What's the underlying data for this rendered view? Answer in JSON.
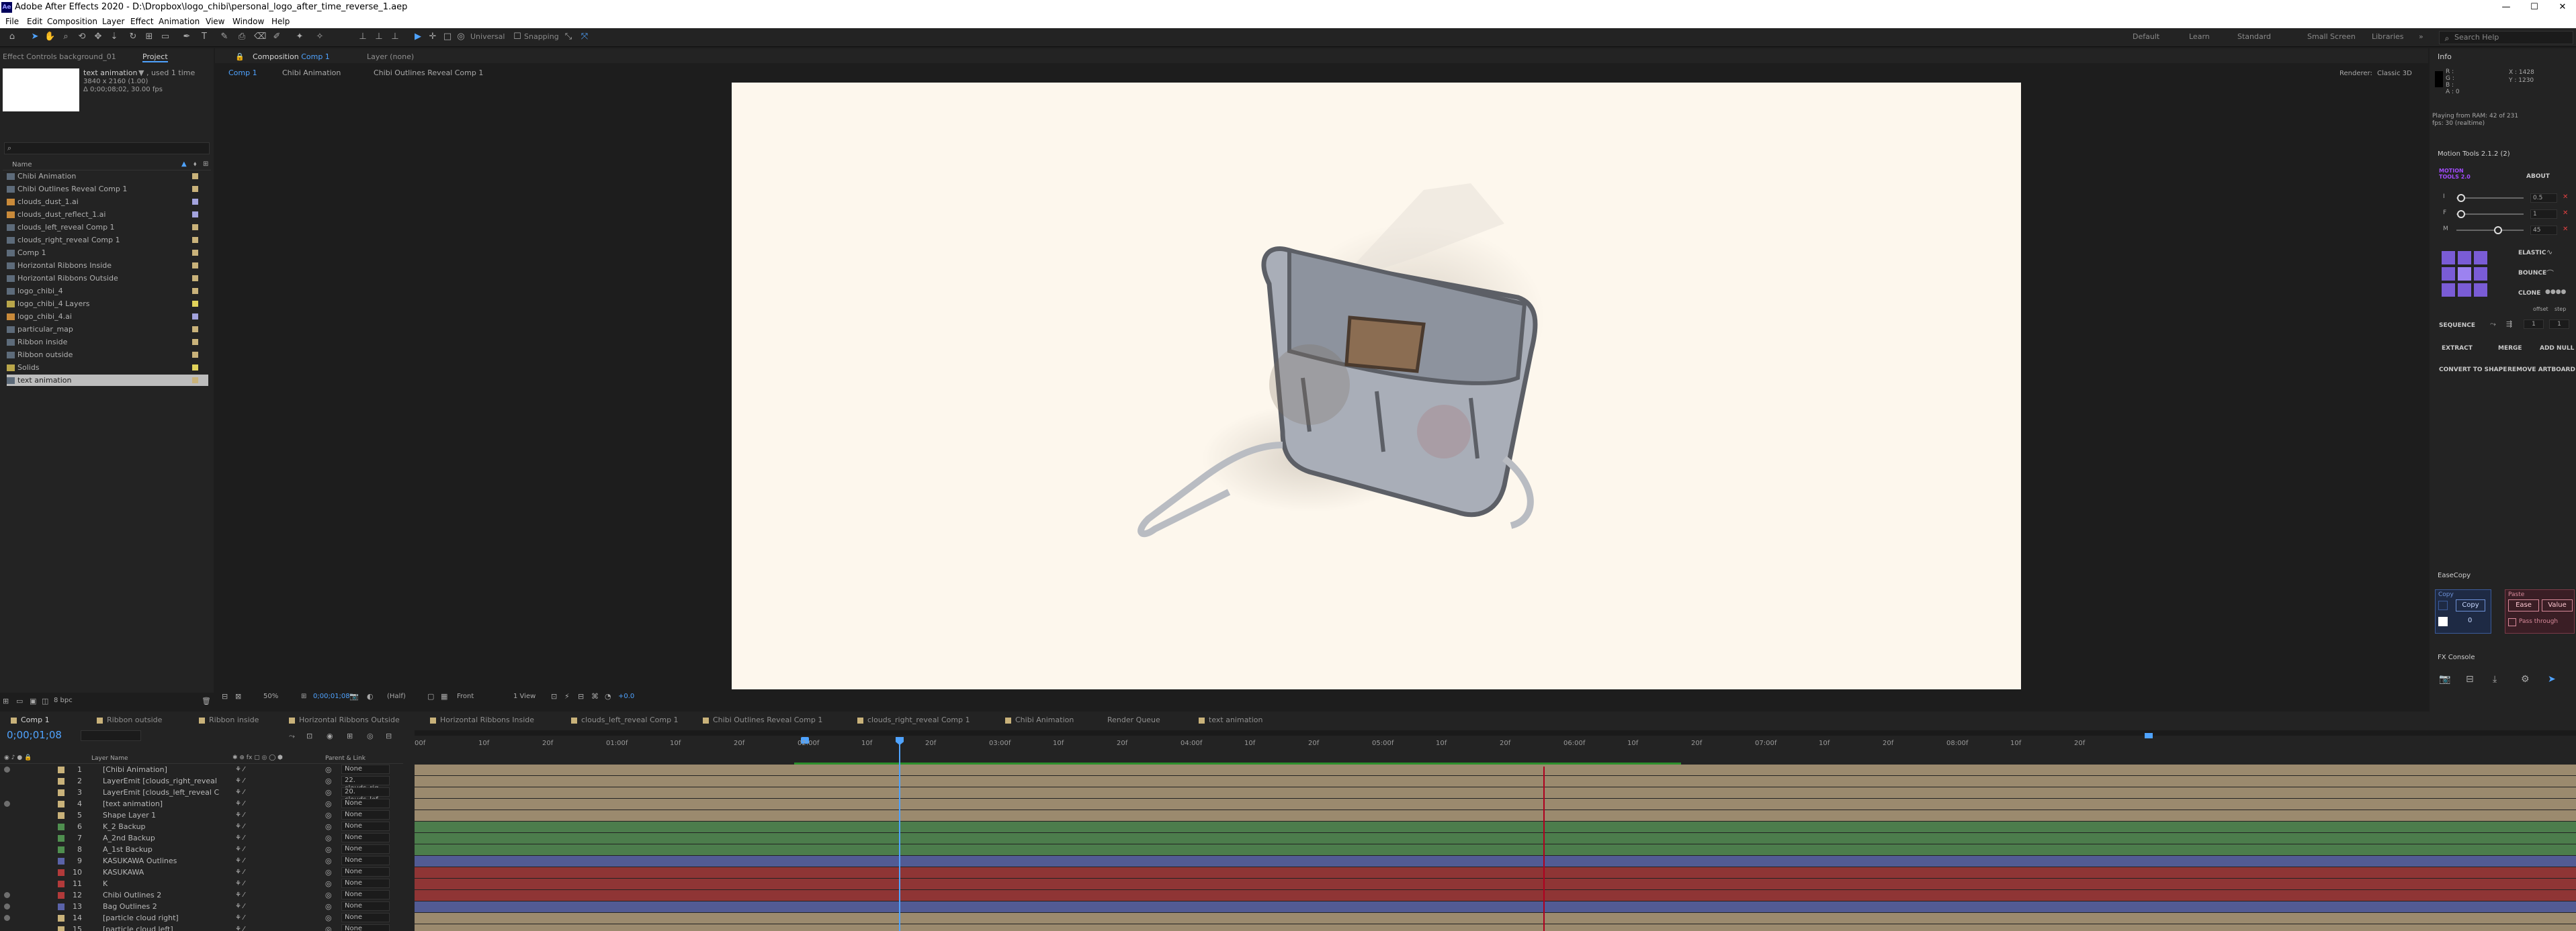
{
  "app": {
    "icon_text": "Ae",
    "title": "Adobe After Effects 2020 - D:\\Dropbox\\logo_chibi\\personal_logo_after_time_reverse_1.aep",
    "window_controls": [
      "—",
      "☐",
      "✕"
    ]
  },
  "menu": [
    "File",
    "Edit",
    "Composition",
    "Layer",
    "Effect",
    "Animation",
    "View",
    "Window",
    "Help"
  ],
  "toolbar": {
    "universal_label": "Universal",
    "snapping_label": "Snapping",
    "workspaces": [
      "Default",
      "Learn",
      "Standard",
      "Small Screen",
      "Libraries"
    ],
    "search_placeholder": "Search Help",
    "workspace_menu": "»"
  },
  "project_panel": {
    "tabs": [
      "Effect Controls background_01",
      "Project"
    ],
    "selected_name": "text animation",
    "selected_used": "▼ , used 1 time",
    "selected_size": "3840 x 2160 (1.00)",
    "selected_duration": "Δ 0;00;08;02, 30.00 fps",
    "search_placeholder": "",
    "col_name": "Name",
    "items": [
      {
        "name": "Chibi Animation",
        "type": "comp",
        "color": "#c9b27a"
      },
      {
        "name": "Chibi Outlines Reveal Comp 1",
        "type": "comp",
        "color": "#c9b27a"
      },
      {
        "name": "clouds_dust_1.ai",
        "type": "ai",
        "color": "#a3a3dd"
      },
      {
        "name": "clouds_dust_reflect_1.ai",
        "type": "ai",
        "color": "#a3a3dd"
      },
      {
        "name": "clouds_left_reveal Comp 1",
        "type": "comp",
        "color": "#c9b27a"
      },
      {
        "name": "clouds_right_reveal Comp 1",
        "type": "comp",
        "color": "#c9b27a"
      },
      {
        "name": "Comp 1",
        "type": "comp",
        "color": "#c9b27a"
      },
      {
        "name": "Horizontal Ribbons Inside",
        "type": "comp",
        "color": "#c9b27a"
      },
      {
        "name": "Horizontal Ribbons Outside",
        "type": "comp",
        "color": "#c9b27a"
      },
      {
        "name": "logo_chibi_4",
        "type": "comp",
        "color": "#c9b27a"
      },
      {
        "name": "logo_chibi_4 Layers",
        "type": "folder",
        "color": "#e0d25a"
      },
      {
        "name": "logo_chibi_4.ai",
        "type": "ai",
        "color": "#a3a3dd"
      },
      {
        "name": "particular_map",
        "type": "comp",
        "color": "#c9b27a"
      },
      {
        "name": "Ribbon inside",
        "type": "comp",
        "color": "#c9b27a"
      },
      {
        "name": "Ribbon outside",
        "type": "comp",
        "color": "#c9b27a"
      },
      {
        "name": "Solids",
        "type": "folder",
        "color": "#e0d25a"
      },
      {
        "name": "text animation",
        "type": "comp",
        "color": "#c9b27a",
        "selected": true
      }
    ],
    "bpc": "8 bpc"
  },
  "composition_panel": {
    "tab_label": "Composition",
    "tab_comp": "Comp 1",
    "layer_tab": "Layer (none)",
    "breadcrumbs": [
      "Comp 1",
      "Chibi Animation",
      "Chibi Outlines Reveal Comp 1"
    ],
    "renderer_label": "Renderer:",
    "renderer_value": "Classic 3D",
    "zoom": "50%",
    "timecode": "0;00;01;08",
    "resolution": "(Half)",
    "view": "Front",
    "views": "1 View",
    "exposure": "+0.0"
  },
  "info_panel": {
    "title": "Info",
    "r": "R :",
    "g": "G :",
    "b": "B :",
    "a": "A : 0",
    "x": "X : 1428",
    "y": "Y : 1230",
    "ram_line1": "Playing from RAM: 42 of 231",
    "ram_line2": "fps: 30 (realtime)"
  },
  "motion_tools": {
    "title": "Motion Tools 2.1.2 (2)",
    "brand": "MOTION TOOLS 2.0",
    "about": "ABOUT",
    "sliders": [
      {
        "label": "I",
        "value": "0.5",
        "level": 0.05
      },
      {
        "label": "F",
        "value": "1",
        "level": 0.05
      },
      {
        "label": "M",
        "value": "45",
        "level": 0.6
      }
    ],
    "elastic": "ELASTIC",
    "bounce": "BOUNCE",
    "clone": "CLONE",
    "offset": "offset",
    "step": "step",
    "sequence": "SEQUENCE",
    "seq_values": [
      "1",
      "1"
    ],
    "extract": "EXTRACT",
    "merge": "MERGE",
    "add_null": "ADD NULL",
    "convert": "CONVERT TO SHAPE",
    "remove_artboard": "REMOVE ARTBOARD"
  },
  "ease_copy": {
    "title": "EaseCopy",
    "copy_section": "Copy",
    "copy_button": "Copy",
    "copy_value": "0",
    "paste_section": "Paste",
    "ease_button": "Ease",
    "value_button": "Value",
    "pass_through": "Pass through"
  },
  "fx_console": {
    "title": "FX Console"
  },
  "timeline": {
    "tabs": [
      {
        "label": "Comp 1",
        "color": "#c9b27a",
        "active": true
      },
      {
        "label": "Ribbon outside",
        "color": "#c9b27a"
      },
      {
        "label": "Ribbon inside",
        "color": "#c9b27a"
      },
      {
        "label": "Horizontal Ribbons Outside",
        "color": "#c9b27a"
      },
      {
        "label": "Horizontal Ribbons Inside",
        "color": "#c9b27a"
      },
      {
        "label": "clouds_left_reveal Comp 1",
        "color": "#c9b27a"
      },
      {
        "label": "Chibi Outlines Reveal Comp 1",
        "color": "#c9b27a"
      },
      {
        "label": "clouds_right_reveal Comp 1",
        "color": "#c9b27a"
      },
      {
        "label": "Chibi Animation",
        "color": "#c9b27a"
      },
      {
        "label": "Render Queue",
        "color": ""
      },
      {
        "label": "text animation",
        "color": "#c9b27a"
      }
    ],
    "current_time": "0;00;01;08",
    "col_layer_name": "Layer Name",
    "col_parent": "Parent & Link",
    "ruler": [
      "00f",
      "10f",
      "20f",
      "01:00f",
      "10f",
      "20f",
      "02:00f",
      "10f",
      "20f",
      "03:00f",
      "10f",
      "20f",
      "04:00f",
      "10f",
      "20f",
      "05:00f",
      "10f",
      "20f",
      "06:00f",
      "10f",
      "20f",
      "07:00f",
      "10f",
      "20f",
      "08:00f",
      "10f",
      "20f"
    ],
    "layers": [
      {
        "num": "1",
        "name": "[Chibi Animation]",
        "label": "#c9b27a",
        "parent": "None",
        "bar": "#9b8a6e",
        "eye": true
      },
      {
        "num": "2",
        "name": "LayerEmit [clouds_right_reveal",
        "label": "#c9b27a",
        "parent": "22. clouds_rig",
        "bar": "#9b8a6e",
        "eye": false
      },
      {
        "num": "3",
        "name": "LayerEmit [clouds_left_reveal C",
        "label": "#c9b27a",
        "parent": "20. clouds_lef",
        "bar": "#9b8a6e",
        "eye": false
      },
      {
        "num": "4",
        "name": "[text animation]",
        "label": "#c9b27a",
        "parent": "None",
        "bar": "#9b8a6e",
        "eye": true
      },
      {
        "num": "5",
        "name": "Shape Layer 1",
        "label": "#c9b27a",
        "parent": "None",
        "bar": "#9b8a6e",
        "eye": false
      },
      {
        "num": "6",
        "name": "K_2 Backup",
        "label": "#4f8f4f",
        "parent": "None",
        "bar": "#4c7d4c",
        "eye": false
      },
      {
        "num": "7",
        "name": "A_2nd Backup",
        "label": "#4f8f4f",
        "parent": "None",
        "bar": "#4c7d4c",
        "eye": false
      },
      {
        "num": "8",
        "name": "A_1st Backup",
        "label": "#4f8f4f",
        "parent": "None",
        "bar": "#4c7d4c",
        "eye": false
      },
      {
        "num": "9",
        "name": "KASUKAWA Outlines",
        "label": "#5a63a8",
        "parent": "None",
        "bar": "#525b94",
        "eye": false
      },
      {
        "num": "10",
        "name": "KASUKAWA",
        "label": "#b23a3a",
        "parent": "None",
        "bar": "#8f3535",
        "eye": false
      },
      {
        "num": "11",
        "name": "K",
        "label": "#b23a3a",
        "parent": "None",
        "bar": "#8f3535",
        "eye": false
      },
      {
        "num": "12",
        "name": "Chibi Outlines 2",
        "label": "#b23a3a",
        "parent": "None",
        "bar": "#8f3535",
        "eye": true
      },
      {
        "num": "13",
        "name": "Bag Outlines 2",
        "label": "#5a63a8",
        "parent": "None",
        "bar": "#525b94",
        "eye": true
      },
      {
        "num": "14",
        "name": "[particle cloud right]",
        "label": "#c9b27a",
        "parent": "None",
        "bar": "#9b8a6e",
        "eye": true
      },
      {
        "num": "15",
        "name": "[particle cloud left]",
        "label": "#c9b27a",
        "parent": "None",
        "bar": "#9b8a6e",
        "eye": false
      }
    ]
  }
}
